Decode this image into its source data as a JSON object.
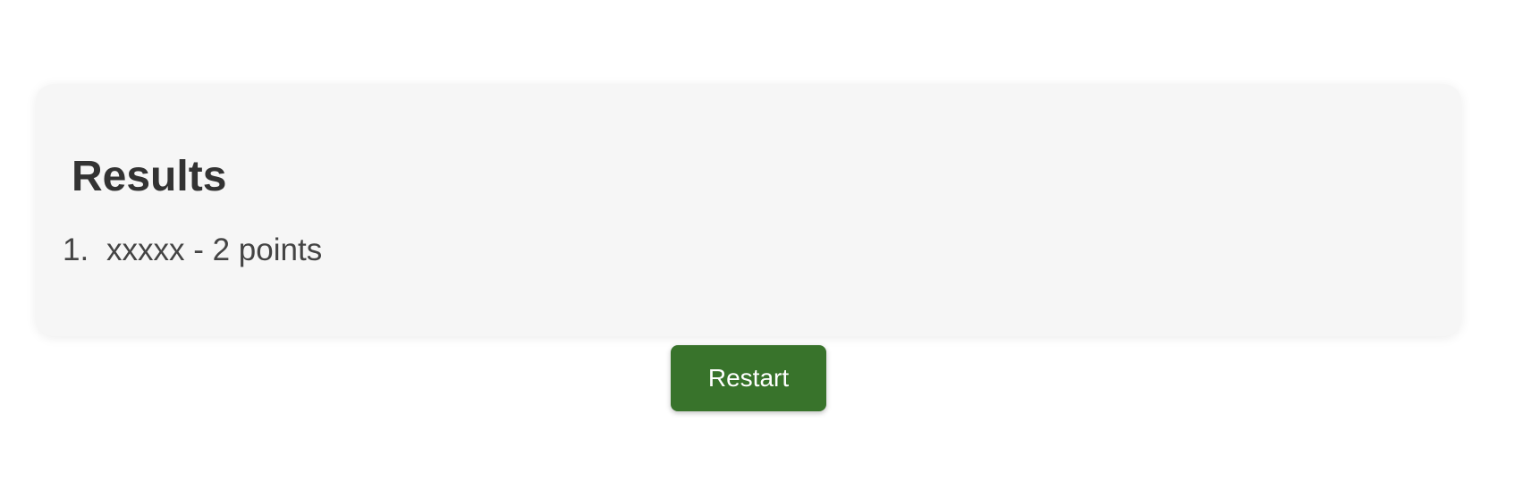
{
  "results": {
    "title": "Results",
    "items": [
      {
        "index": "1.",
        "text": "xxxxx - 2 points"
      }
    ]
  },
  "actions": {
    "restart_label": "Restart"
  },
  "colors": {
    "card_background": "#f6f6f6",
    "button_background": "#38732b",
    "title_text": "#333333",
    "item_text": "#444444"
  }
}
